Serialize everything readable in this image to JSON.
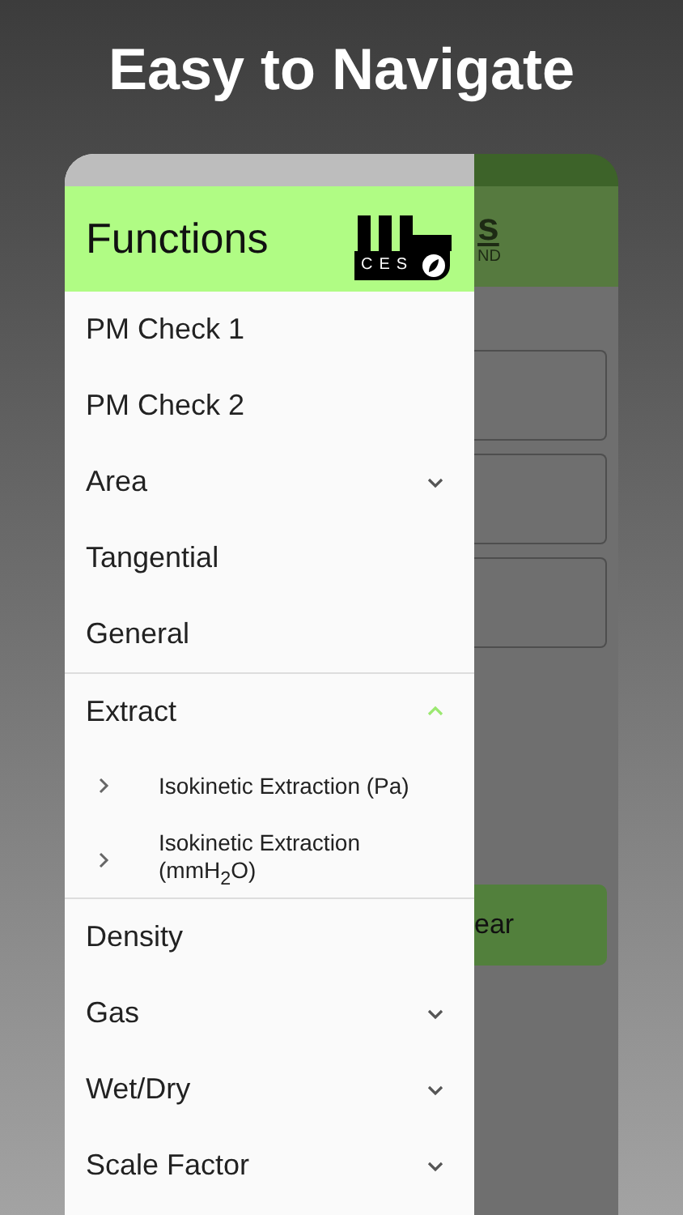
{
  "headline": "Easy to Navigate",
  "drawer": {
    "title": "Functions",
    "logo_text": "CES",
    "items": [
      {
        "label": "PM Check 1",
        "kind": "item"
      },
      {
        "label": "PM Check 2",
        "kind": "item"
      },
      {
        "label": "Area",
        "kind": "group",
        "expanded": false
      },
      {
        "label": "Tangential",
        "kind": "item"
      },
      {
        "label": "General",
        "kind": "item"
      },
      {
        "label": "Extract",
        "kind": "group",
        "expanded": true,
        "children": [
          {
            "label": "Isokinetic Extraction (Pa)"
          },
          {
            "label": "Isokinetic Extraction (mmH$_{2}$O)"
          }
        ]
      },
      {
        "label": "Density",
        "kind": "item"
      },
      {
        "label": "Gas",
        "kind": "group",
        "expanded": false
      },
      {
        "label": "Wet/Dry",
        "kind": "group",
        "expanded": false
      },
      {
        "label": "Scale Factor",
        "kind": "group",
        "expanded": false
      }
    ]
  },
  "background_screen": {
    "title": "s",
    "subtitle": "ND",
    "button": "ear"
  }
}
